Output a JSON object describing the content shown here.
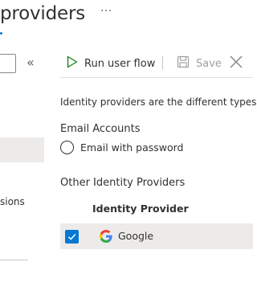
{
  "header": {
    "title": "providers",
    "more_label": "···"
  },
  "left_panel": {
    "collapse_label": "«",
    "partial_text": "sions"
  },
  "toolbar": {
    "run_label": "Run user flow",
    "save_label": "Save"
  },
  "content": {
    "description": "Identity providers are the different types",
    "local_section": {
      "title": "Email Accounts",
      "option_label": "Email with password"
    },
    "other_section": {
      "title": "Other Identity Providers",
      "column_header": "Identity Provider",
      "rows": [
        {
          "name": "Google",
          "checked": true
        }
      ]
    }
  },
  "colors": {
    "accent": "#0078d4",
    "run_icon": "#107c10"
  }
}
